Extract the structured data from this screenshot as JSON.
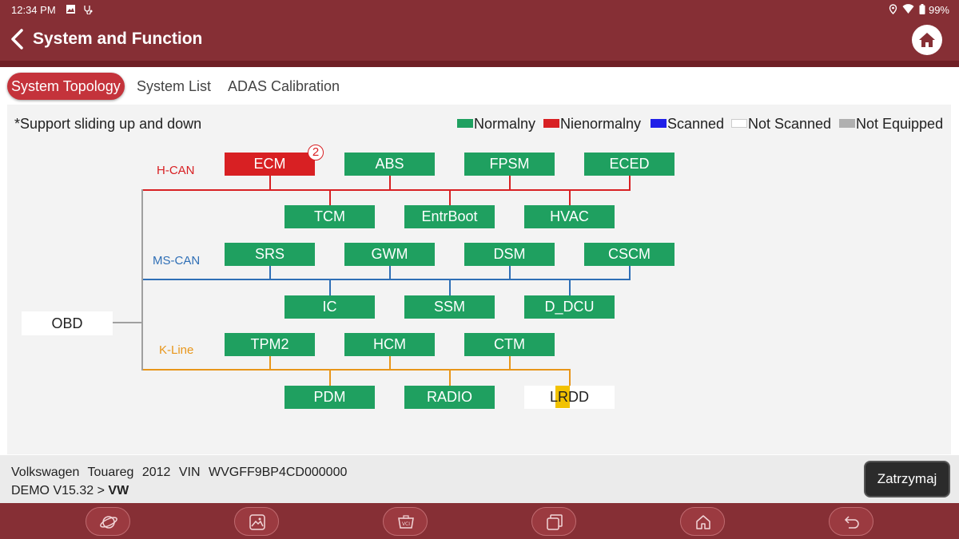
{
  "status_bar": {
    "time": "12:34 PM",
    "battery": "99%"
  },
  "header": {
    "title": "System and Function"
  },
  "tabs": [
    {
      "label": "System Topology",
      "active": true
    },
    {
      "label": "System List",
      "active": false
    },
    {
      "label": "ADAS Calibration",
      "active": false
    }
  ],
  "hint": "*Support sliding up and down",
  "legend": [
    {
      "label": "Normalny",
      "color": "#1fa060"
    },
    {
      "label": "Nienormalny",
      "color": "#d82023"
    },
    {
      "label": "Scanned",
      "color": "#1f1fe8"
    },
    {
      "label": "Not Scanned",
      "color": "#ffffff"
    },
    {
      "label": "Not Equipped",
      "color": "#b0b0b0"
    }
  ],
  "colors": {
    "hcan": "#d82023",
    "mscan": "#2f6fb6",
    "kline": "#e8961a",
    "obd_line": "#a0a0a0",
    "brand": "#862f35"
  },
  "topology": {
    "obd": "OBD",
    "buses": {
      "hcan": "H-CAN",
      "mscan": "MS-CAN",
      "kline": "K-Line"
    },
    "nodes": {
      "ecm": "ECM",
      "abs": "ABS",
      "fpsm": "FPSM",
      "eced": "ECED",
      "tcm": "TCM",
      "entrboot": "EntrBoot",
      "hvac": "HVAC",
      "srs": "SRS",
      "gwm": "GWM",
      "dsm": "DSM",
      "cscm": "CSCM",
      "ic": "IC",
      "ssm": "SSM",
      "d_dcu": "D_DCU",
      "tpm2": "TPM2",
      "hcm": "HCM",
      "ctm": "CTM",
      "pdm": "PDM",
      "radio": "RADIO",
      "lrdd": "LRDD"
    },
    "ecm_fault_count": "2"
  },
  "footer": {
    "vehicle": "Volkswagen Touareg 2012 VIN WVGFF9BP4CD000000",
    "version": "DEMO V15.32 >",
    "brand": "VW",
    "stop_button": "Zatrzymaj"
  },
  "bottom_nav_icons": [
    "planet-icon",
    "gallery-icon",
    "vci-icon",
    "recent-apps-icon",
    "home-icon",
    "back-icon"
  ]
}
